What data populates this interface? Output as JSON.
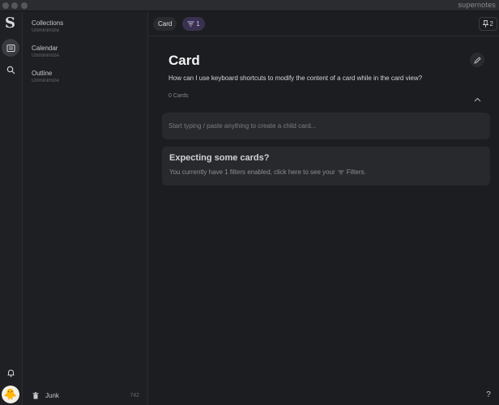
{
  "app": {
    "brand": "supernotes"
  },
  "sidebar": {
    "items": [
      {
        "title": "Collections",
        "subtitle": "Unminimize"
      },
      {
        "title": "Calendar",
        "subtitle": "Unminimize"
      },
      {
        "title": "Outline",
        "subtitle": "Unminimize"
      }
    ],
    "junk": {
      "label": "Junk",
      "count": "742"
    }
  },
  "topbar": {
    "tab_label": "Card",
    "filter_count": "1",
    "pinned_count": "2"
  },
  "card": {
    "title": "Card",
    "question": "How can I use keyboard shortcuts to modify the content of a card while in the card view?",
    "count_label": "0 Cards"
  },
  "input": {
    "placeholder": "Start typing / paste anything to create a child card..."
  },
  "empty_state": {
    "title": "Expecting some cards?",
    "text_before": "You currently have 1 filters enabled, click here to see your",
    "text_after": "Filters."
  },
  "help": {
    "label": "?"
  },
  "colors": {
    "accent_filter_bg": "#3a3150",
    "background": "#1c1d20"
  }
}
